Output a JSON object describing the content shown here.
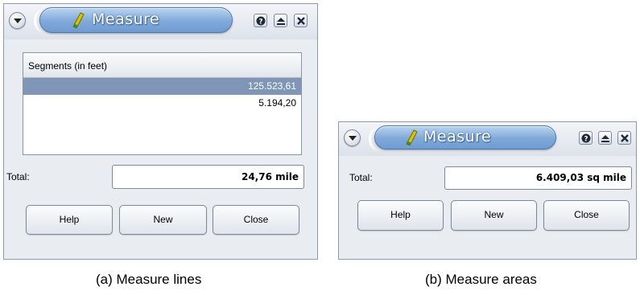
{
  "window_a": {
    "title": "Measure",
    "table_header": "Segments (in feet)",
    "segments": [
      "125.523,61",
      "5.194,20"
    ],
    "total_label": "Total:",
    "total_value": "24,76 mile",
    "buttons": {
      "help": "Help",
      "new": "New",
      "close": "Close"
    }
  },
  "window_b": {
    "title": "Measure",
    "total_label": "Total:",
    "total_value": "6.409,03 sq mile",
    "buttons": {
      "help": "Help",
      "new": "New",
      "close": "Close"
    }
  },
  "captions": {
    "a": "(a)  Measure lines",
    "b": "(b)  Measure areas"
  },
  "icons": [
    "window-menu-icon",
    "measure-icon",
    "help-icon",
    "shade-icon",
    "close-icon"
  ],
  "colors": {
    "title_pill": "#7fa9d9",
    "selected_row": "#7f96b6",
    "window_bg": "#e9ecf1"
  }
}
